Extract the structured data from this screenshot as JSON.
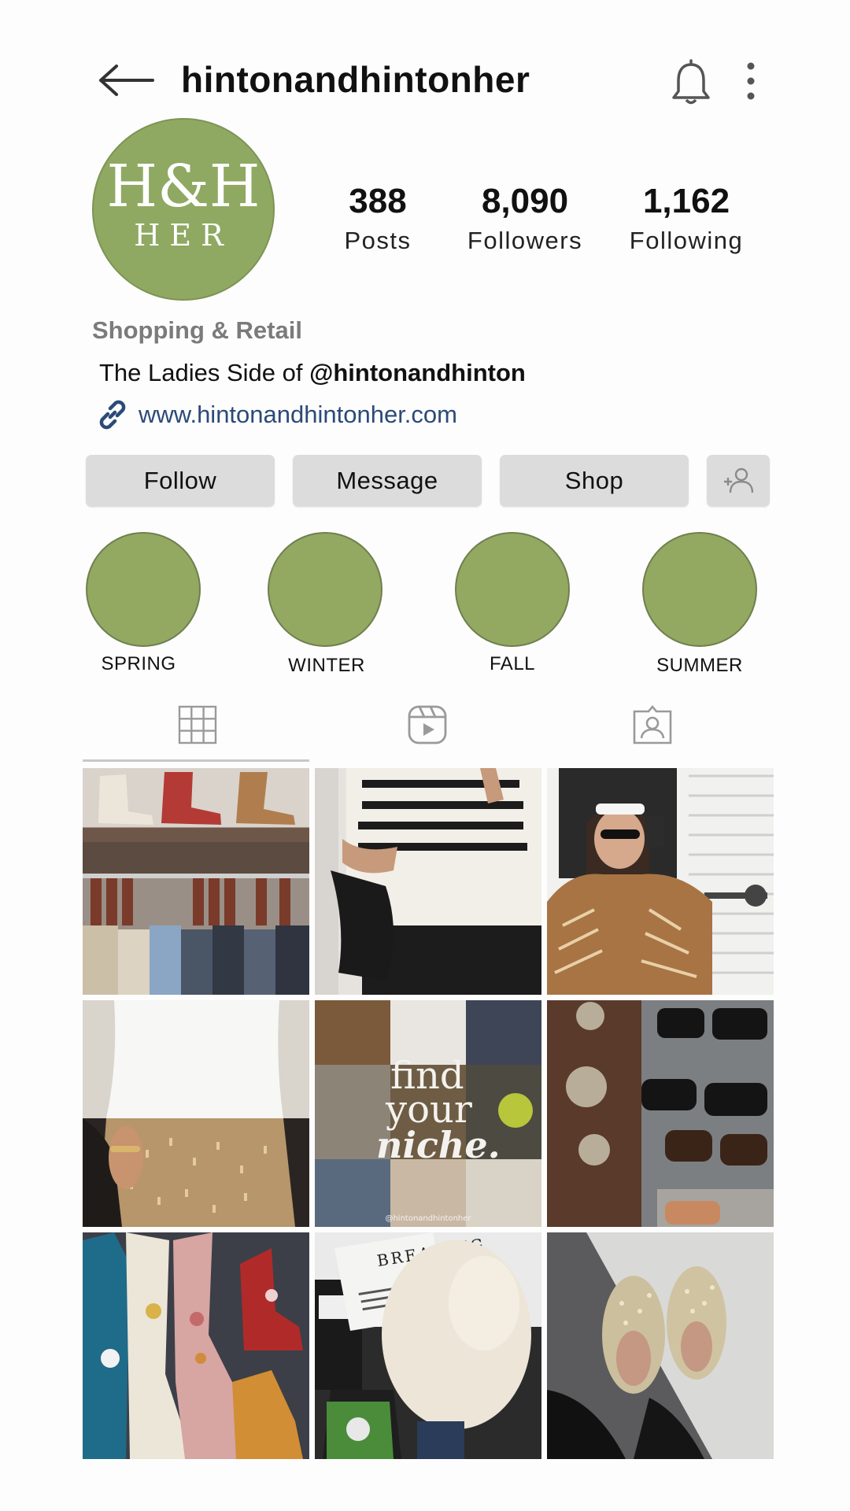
{
  "header": {
    "username": "hintonandhintonher",
    "icons": [
      "back-arrow-icon",
      "bell-icon",
      "more-vertical-icon"
    ]
  },
  "profile": {
    "avatar_logo": {
      "top": "H&H",
      "bottom": "HER"
    },
    "stats": [
      {
        "value": "388",
        "label": "Posts"
      },
      {
        "value": "8,090",
        "label": "Followers"
      },
      {
        "value": "1,162",
        "label": "Following"
      }
    ],
    "category": "Shopping & Retail",
    "bio_prefix": "The Ladies Side of ",
    "bio_mention": "@hintonandhinton",
    "website": "www.hintonandhintonher.com"
  },
  "actions": {
    "follow": "Follow",
    "message": "Message",
    "shop": "Shop",
    "add_user_icon": "add-user-icon"
  },
  "highlights": [
    {
      "label": "SPRING"
    },
    {
      "label": "WINTER"
    },
    {
      "label": "FALL"
    },
    {
      "label": "SUMMER"
    }
  ],
  "tabs": [
    "grid-icon",
    "reels-icon",
    "tagged-icon"
  ],
  "posts": [
    {
      "overlay": ""
    },
    {
      "overlay": ""
    },
    {
      "overlay": ""
    },
    {
      "overlay": ""
    },
    {
      "overlay": "find your niche.",
      "handle": "@hintonandhintonher"
    },
    {
      "overlay": ""
    },
    {
      "overlay": ""
    },
    {
      "overlay": "BREAKING",
      "subtext": "H&H NOW PARTNERING WITH HINTON & HINTON HER TO PROVIDE LATEST & HOTTEST FASHION TRENDS"
    },
    {
      "overlay": ""
    }
  ],
  "colors": {
    "brand_green": "#8fa962",
    "highlight_green": "#93a961",
    "button_bg": "#dcdcdc",
    "link_blue": "#2b4a78"
  }
}
